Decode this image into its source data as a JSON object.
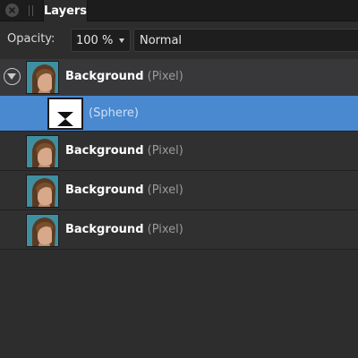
{
  "panel": {
    "tab_label": "Layers",
    "close_icon": "close-icon",
    "grip_icon": "grip-icon"
  },
  "opacity": {
    "label": "Opacity:",
    "value": "100 %"
  },
  "blend_mode": {
    "value": "Normal"
  },
  "layers": [
    {
      "name": "Background",
      "type": "(Pixel)",
      "expanded": true
    },
    {
      "name": "(Sphere)",
      "kind": "mask",
      "selected": true
    },
    {
      "name": "Background",
      "type": "(Pixel)"
    },
    {
      "name": "Background",
      "type": "(Pixel)"
    },
    {
      "name": "Background",
      "type": "(Pixel)"
    }
  ],
  "colors": {
    "selection": "#4a88d0",
    "panel_bg": "#2d2d2e",
    "thumb_bg": "#3e8fa1"
  }
}
